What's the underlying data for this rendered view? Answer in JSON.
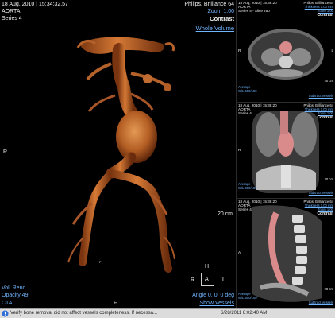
{
  "main_view": {
    "date_time": "18 Aug, 2010 | 15:34:32.57",
    "study": "AORTA",
    "series": "Series 4",
    "scanner": "Philips, Brilliance 64",
    "zoom": "Zoom 1.00",
    "contrast": "Contrast",
    "volume_mode": "Whole Volume",
    "left_marker": "R",
    "bottom_marker": "F",
    "right_marker_small": "F",
    "scale": "20 cm",
    "render_mode": "Vol. Rend.",
    "opacity": "Opacity 49",
    "modality": "CTA",
    "angle": "Angle 0, 0, 0 deg",
    "show_vessels": "Show Vessels",
    "orient_top": "H",
    "orient_left": "R",
    "orient_center": "A",
    "orient_right": "L",
    "orient_bottom": "F"
  },
  "axial_view": {
    "date": "18 Aug, 2010 | 15:36:20",
    "study": "AORTA",
    "series": "Series 4 - Slice 250",
    "scanner": "Philips, Brilliance 64",
    "thickness": "Thickness 1.00 mm",
    "zoom": "Zoom 1.00",
    "contrast": "Contrast",
    "window": "Average",
    "width_level": "W/L 600/100",
    "link": "Subtract Vessels",
    "marker_r": "R",
    "marker_l": "L",
    "scale": "20 cm"
  },
  "coronal_view": {
    "date": "18 Aug, 2010 | 15:36:20",
    "study": "AORTA",
    "series": "Series 4",
    "scanner": "Philips, Brilliance 64",
    "thickness": "Thickness 1.00 mm",
    "zoom": "Zoom 1.00",
    "contrast": "Contrast",
    "window": "Average",
    "width_level": "W/L 600/100",
    "link": "Subtract Vessels",
    "marker_r": "R",
    "scale": "20 cm"
  },
  "sagittal_view": {
    "date": "18 Aug, 2010 | 15:36:20",
    "study": "AORTA",
    "series": "Series 4",
    "scanner": "Philips, Brilliance 64",
    "thickness": "Thickness 1.00 mm",
    "zoom": "Zoom 1.00",
    "contrast": "Contrast",
    "window": "Average",
    "width_level": "W/L 600/100",
    "link": "Subtract Vessels",
    "marker_a": "A",
    "scale": "20 cm"
  },
  "status_bar": {
    "message": "Verify bone removal did not affect vessels completeness. If necessa...",
    "timestamp": "6/28/2011 8:02:40 AM"
  },
  "colors": {
    "accent_blue": "#6fb5ff",
    "vessel": "#c86a2d",
    "highlight": "#d98b8b"
  }
}
